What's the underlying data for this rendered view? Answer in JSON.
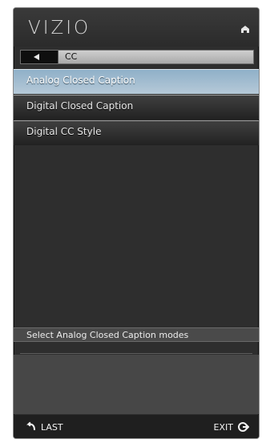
{
  "app": {
    "brand": "VIZIO"
  },
  "header": {
    "home_icon": "home-icon"
  },
  "breadcrumb": {
    "back_icon": "back-arrow-icon",
    "title": "CC"
  },
  "menu": {
    "items": [
      {
        "label": "Analog Closed Caption",
        "selected": true
      },
      {
        "label": "Digital Closed Caption",
        "selected": false
      },
      {
        "label": "Digital CC Style",
        "selected": false
      }
    ]
  },
  "description": {
    "text": "Select Analog Closed Caption modes"
  },
  "footer": {
    "last_label": "LAST",
    "exit_label": "EXIT",
    "last_icon": "return-icon",
    "exit_icon": "exit-icon"
  },
  "colors": {
    "selected_row": "#a9c0d2",
    "panel_background": "#2e2e2e"
  }
}
